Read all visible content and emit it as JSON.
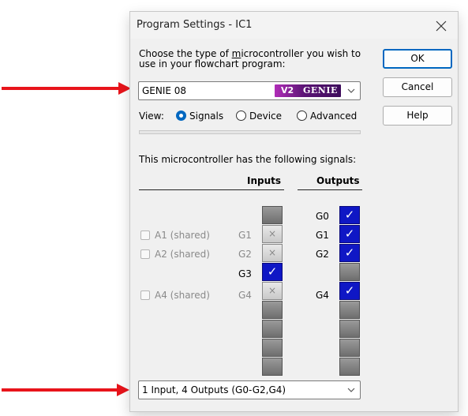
{
  "window": {
    "title": "Program Settings - IC1"
  },
  "prompt": {
    "line1_pre": "Choose the type of ",
    "line1_u": "m",
    "line1_post": "icrocontroller you wish to",
    "line2": "use in your flowchart program:"
  },
  "buttons": {
    "ok": "OK",
    "cancel": "Cancel",
    "help": "Help"
  },
  "controller_select": {
    "value": "GENIE 08",
    "logo_v2": "V2",
    "logo_genie": "GENIE"
  },
  "view": {
    "label": "View:",
    "options": [
      {
        "label": "Signals",
        "selected": true
      },
      {
        "label": "Device",
        "selected": false
      },
      {
        "label": "Advanced",
        "selected": false
      }
    ]
  },
  "signals": {
    "heading": "This microcontroller has the following signals:",
    "inputs_label": "Inputs",
    "outputs_label": "Outputs",
    "inputs": [
      {
        "pin": "G1",
        "state": "disabled",
        "analog": "A1 (shared)"
      },
      {
        "pin": "G2",
        "state": "disabled",
        "analog": "A2 (shared)"
      },
      {
        "pin": "G3",
        "state": "checked",
        "analog": ""
      },
      {
        "pin": "G4",
        "state": "disabled",
        "analog": "A4 (shared)"
      }
    ],
    "outputs": [
      "G0",
      "G1",
      "G2",
      "G4"
    ]
  },
  "config_select": {
    "value": "1 Input, 4 Outputs (G0-G2,G4)"
  },
  "colors": {
    "accent": "#0067c0",
    "checked": "#0f17c5",
    "annotation_arrow": "#e8141b"
  },
  "icons": {
    "close": "close-icon",
    "dropdown": "chevron-down-icon",
    "check": "checkmark-icon",
    "cross": "cross-icon"
  }
}
